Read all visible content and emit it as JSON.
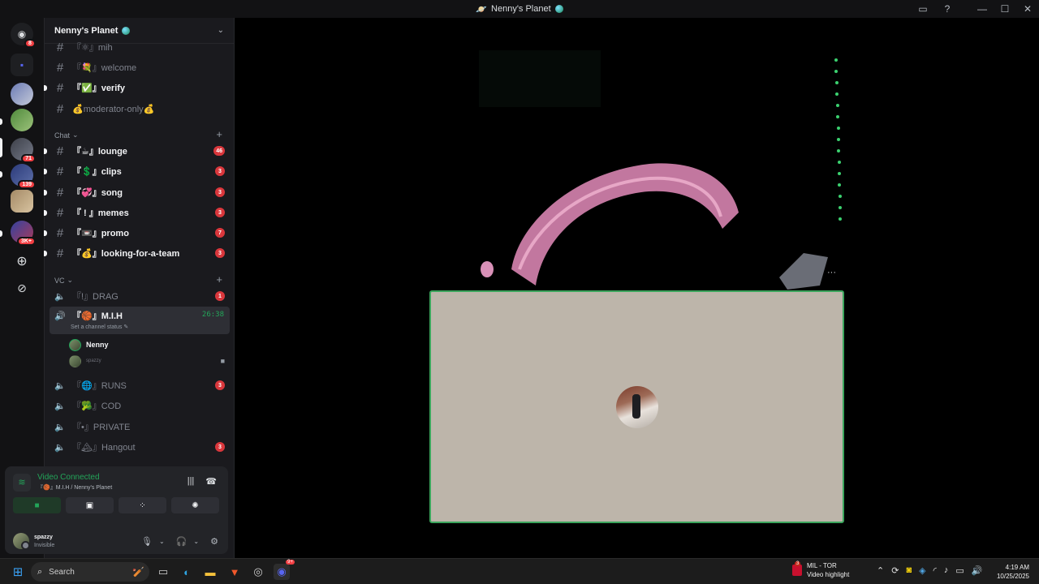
{
  "window": {
    "title": "Nenny's Planet",
    "buttons": {
      "minimize": "—",
      "maximize": "☐",
      "close": "✕"
    }
  },
  "guild_bar": {
    "home_badge": "8",
    "badges": [
      "71",
      "139",
      "3K+"
    ]
  },
  "server": {
    "name": "Nenny's Planet"
  },
  "channels_top": [
    {
      "label": "『⚛』mih",
      "unread": false
    },
    {
      "label": "『💐』welcome",
      "unread": false
    },
    {
      "label": "『✅』verify",
      "unread": true
    },
    {
      "label": "💰moderator-only💰",
      "unread": false
    }
  ],
  "categories": {
    "chat": "Chat",
    "vc": "VC"
  },
  "chat_channels": [
    {
      "label": "『☕』lounge",
      "count": "46"
    },
    {
      "label": "『💲』clips",
      "count": "3"
    },
    {
      "label": "『💞』song",
      "count": "3"
    },
    {
      "label": "『 ! 』memes",
      "count": "3"
    },
    {
      "label": "『📼』promo",
      "count": "7"
    },
    {
      "label": "『💰』looking-for-a-team",
      "count": "3"
    }
  ],
  "voice_channels": {
    "drag": {
      "label": "『!』DRAG",
      "count": "1"
    },
    "active": {
      "label": "『🏀』M.I.H",
      "timer": "26:38",
      "status": "Set a channel status"
    },
    "users": [
      {
        "name": "Nenny"
      },
      {
        "name": "spazzy"
      }
    ],
    "others": [
      {
        "label": "『🌐』RUNS",
        "count": "3"
      },
      {
        "label": "『🥦』COD",
        "count": ""
      },
      {
        "label": "『•』PRIVATE",
        "count": ""
      },
      {
        "label": "『🏔』Hangout",
        "count": "3"
      }
    ]
  },
  "panel": {
    "status": "Video Connected",
    "location": "『🏀』M.I.H / Nenny's Planet",
    "user": {
      "name": "spazzy",
      "presence": "Invisible"
    }
  },
  "stage": {
    "more": "···"
  },
  "taskbar": {
    "search": "Search",
    "weather": {
      "line1": "MIL - TOR",
      "line2": "Video highlight",
      "badge": "3"
    },
    "time": "4:19 AM",
    "date": "10/25/2025",
    "discord_badge": "9+"
  },
  "colors": {
    "accent_green": "#23a559",
    "unread_red": "#da373c",
    "tile_border": "#3ba55c"
  }
}
